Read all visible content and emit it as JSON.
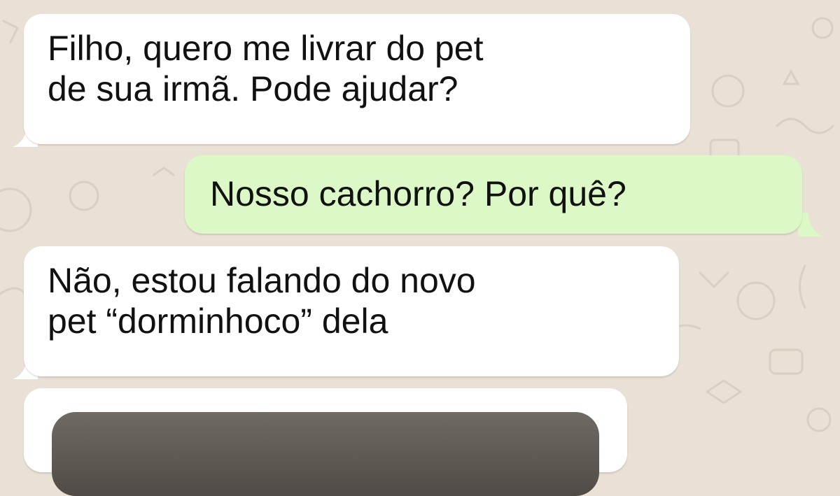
{
  "chat": {
    "messages": [
      {
        "direction": "incoming",
        "lines": [
          "Filho, quero me livrar do pet",
          "de sua irmã. Pode ajudar?"
        ]
      },
      {
        "direction": "outgoing",
        "lines": [
          "Nosso cachorro? Por quê?"
        ]
      },
      {
        "direction": "incoming",
        "lines": [
          "Não, estou falando do novo",
          "pet “dorminhoco” dela"
        ]
      },
      {
        "direction": "incoming",
        "type": "image",
        "lines": []
      }
    ]
  },
  "colors": {
    "background": "#e9e1d6",
    "incoming_bubble": "#ffffff",
    "outgoing_bubble": "#dcf8c6",
    "text": "#111111"
  }
}
